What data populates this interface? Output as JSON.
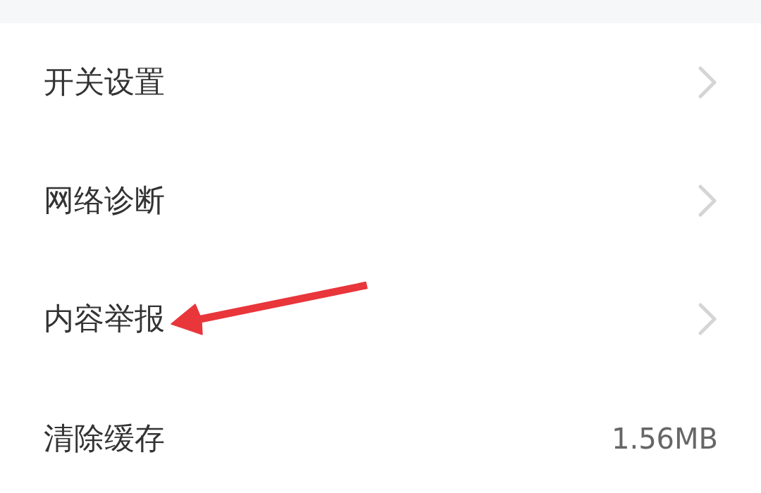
{
  "settings": [
    {
      "label": "开关设置",
      "kind": "link",
      "pointed_by_arrow": false
    },
    {
      "label": "网络诊断",
      "kind": "link",
      "pointed_by_arrow": false
    },
    {
      "label": "内容举报",
      "kind": "link",
      "pointed_by_arrow": true
    },
    {
      "label": "清除缓存",
      "kind": "value",
      "value": "1.56MB",
      "pointed_by_arrow": false
    }
  ]
}
